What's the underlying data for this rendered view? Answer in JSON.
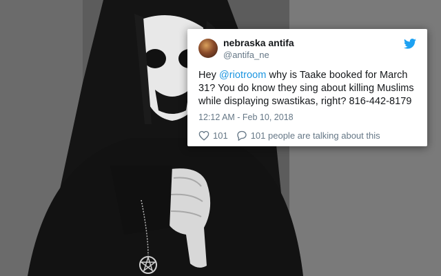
{
  "tweet": {
    "display_name": "nebraska antifa",
    "handle": "@antifa_ne",
    "text_before": "Hey ",
    "mention": "@riotroom",
    "text_after": " why is Taake booked for March 31? You do know they sing about killing Muslims while displaying swastikas, right? 816-442-8179",
    "timestamp": "12:12 AM - Feb 10, 2018",
    "likes_count": "101",
    "talking_text": "101 people are talking about this"
  },
  "icons": {
    "brand": "twitter-bird-icon",
    "like": "heart-icon",
    "reply": "speech-bubble-icon"
  },
  "colors": {
    "link": "#1b95e0",
    "secondary_text": "#657786",
    "primary_text": "#14171a",
    "card_background": "#ffffff"
  }
}
